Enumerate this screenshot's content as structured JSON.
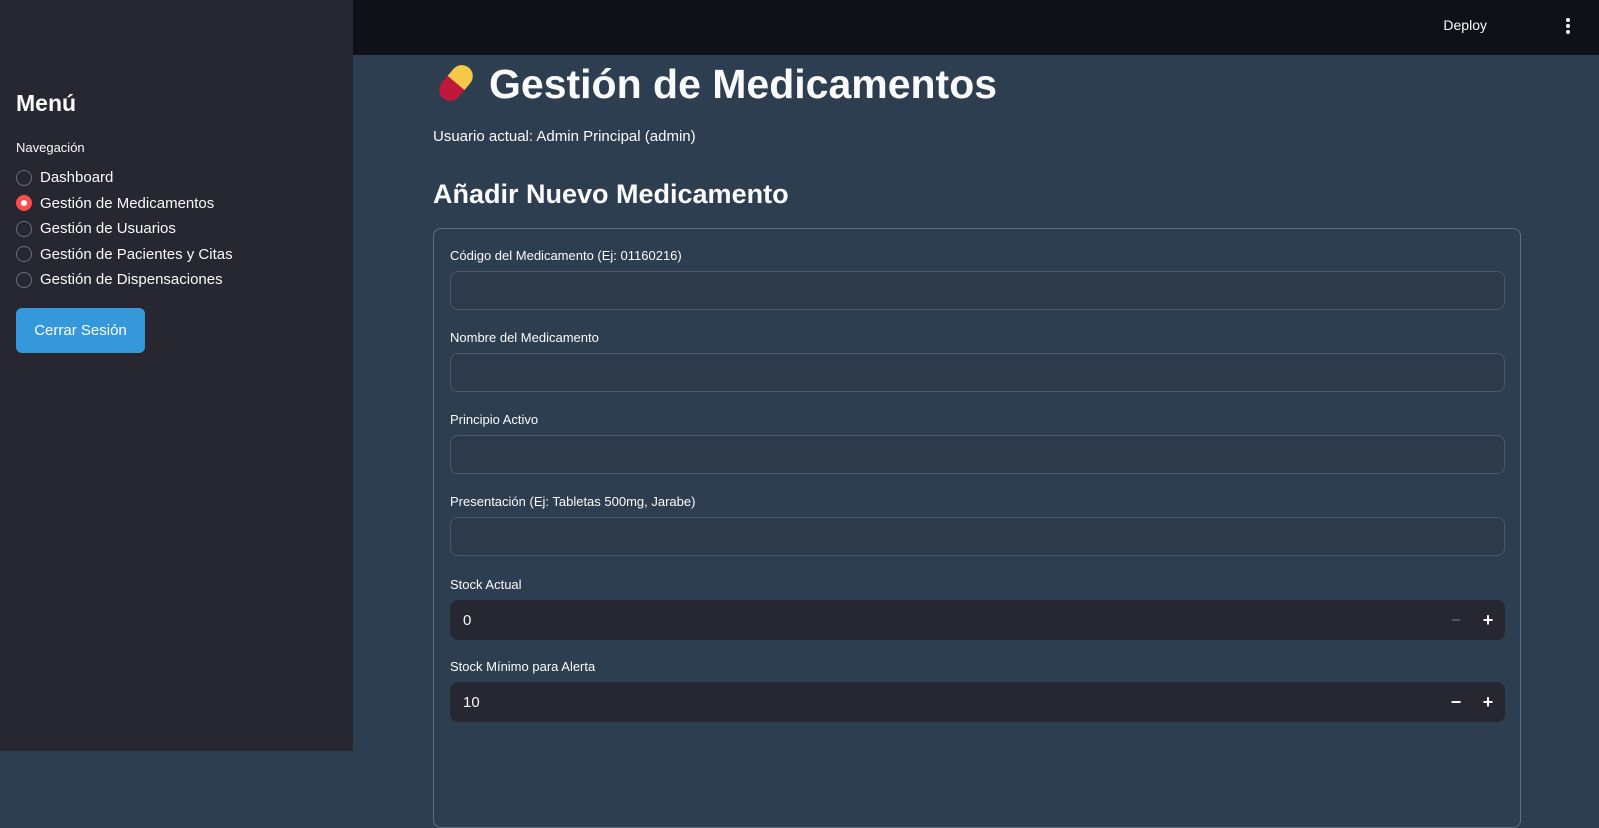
{
  "sidebar": {
    "title": "Menú",
    "nav_label": "Navegación",
    "items": [
      {
        "label": "Dashboard",
        "selected": false
      },
      {
        "label": "Gestión de Medicamentos",
        "selected": true
      },
      {
        "label": "Gestión de Usuarios",
        "selected": false
      },
      {
        "label": "Gestión de Pacientes y Citas",
        "selected": false
      },
      {
        "label": "Gestión de Dispensaciones",
        "selected": false
      }
    ],
    "logout_label": "Cerrar Sesión"
  },
  "topbar": {
    "deploy_label": "Deploy",
    "menu_icon": "kebab-menu-icon"
  },
  "main": {
    "title_icon": "pill-icon",
    "title": "Gestión de Medicamentos",
    "current_user": "Usuario actual: Admin Principal (admin)",
    "subtitle": "Añadir Nuevo Medicamento",
    "fields": {
      "codigo": {
        "label": "Código del Medicamento (Ej: 01160216)",
        "value": ""
      },
      "nombre": {
        "label": "Nombre del Medicamento",
        "value": ""
      },
      "principio": {
        "label": "Principio Activo",
        "value": ""
      },
      "presentacion": {
        "label": "Presentación (Ej: Tabletas 500mg, Jarabe)",
        "value": ""
      },
      "stock_actual": {
        "label": "Stock Actual",
        "value": "0",
        "minus": "−",
        "plus": "+"
      },
      "stock_minimo": {
        "label": "Stock Mínimo para Alerta",
        "value": "10",
        "minus": "−",
        "plus": "+"
      }
    }
  },
  "colors": {
    "sidebar_bg": "#262730",
    "main_bg": "#2e3e51",
    "topbar_bg": "#0e1117",
    "accent_radio": "#ff4b4b",
    "button_bg": "#3498db"
  }
}
